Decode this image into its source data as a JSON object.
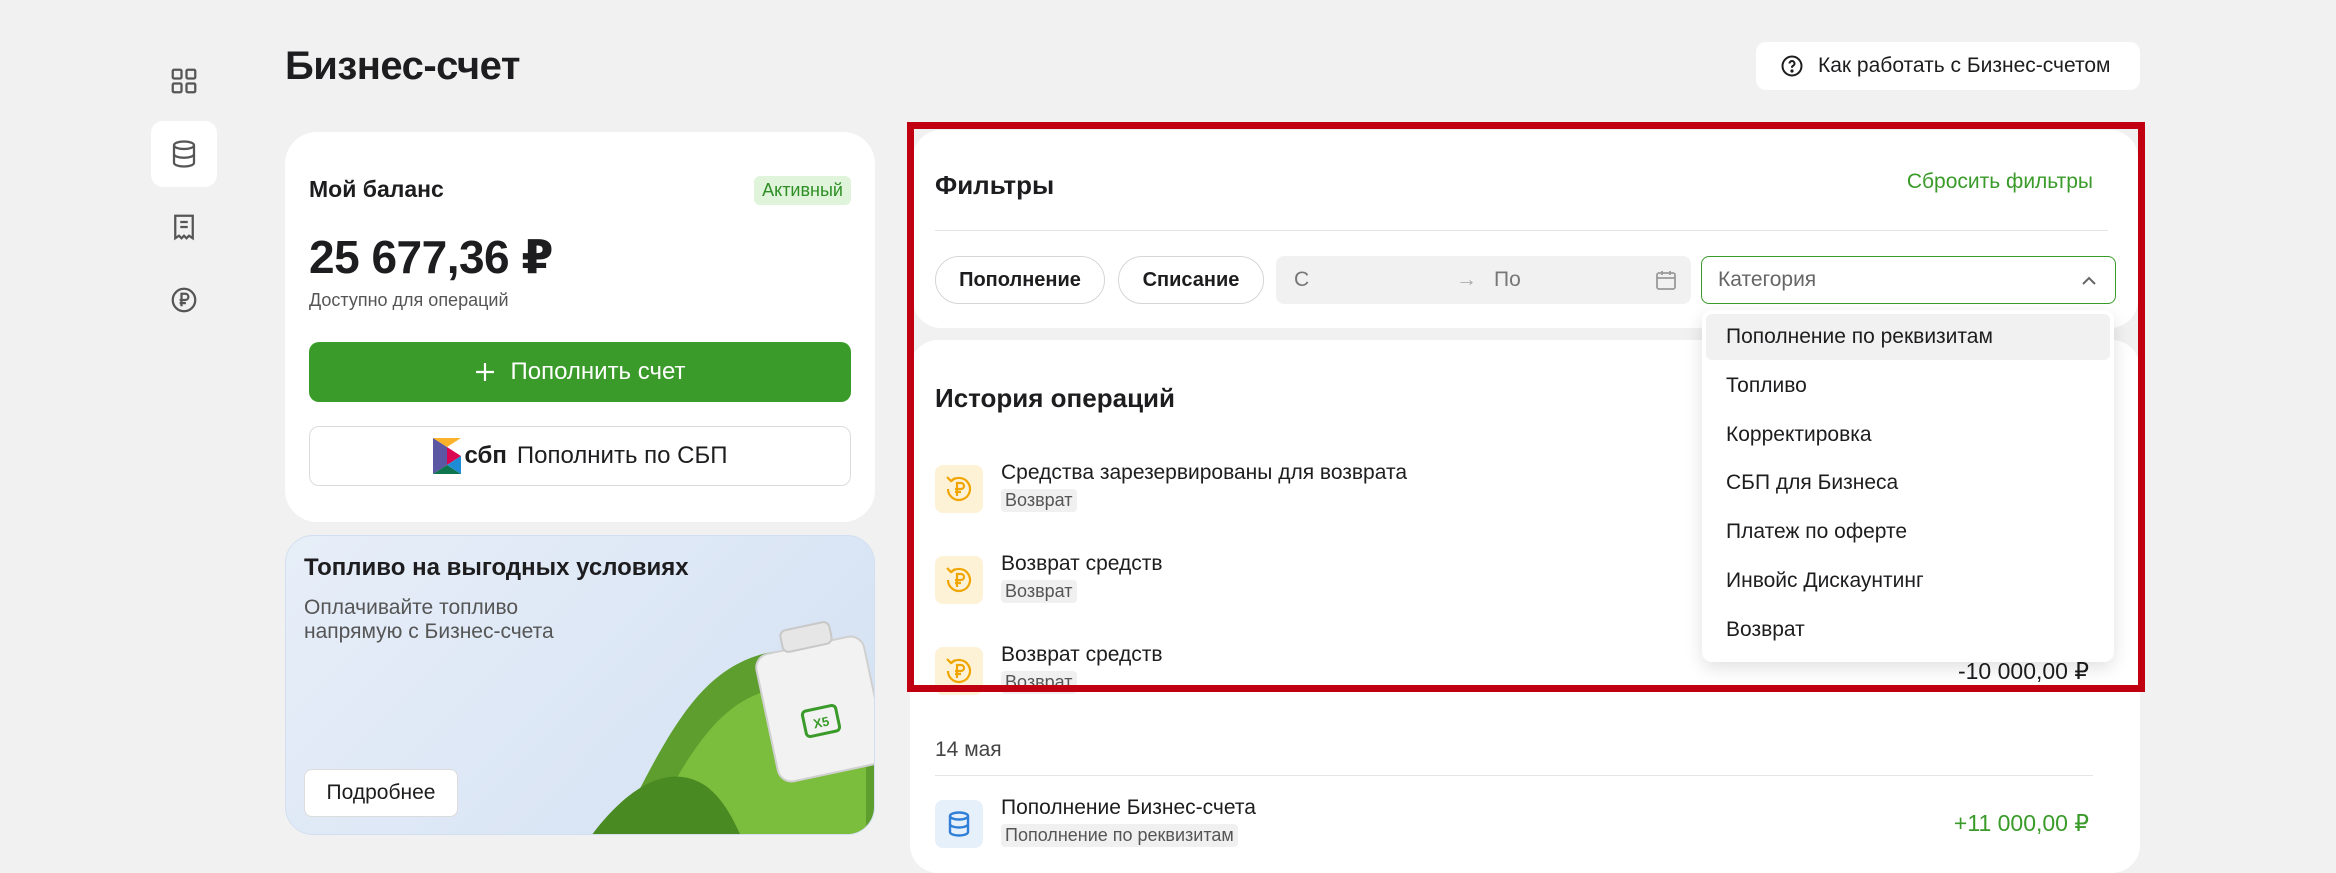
{
  "sidebar": {
    "items": [
      {
        "icon": "dashboard-grid-icon",
        "active": false
      },
      {
        "icon": "database-icon",
        "active": true
      },
      {
        "icon": "document-icon",
        "active": false
      },
      {
        "icon": "ruble-coin-icon",
        "active": false
      }
    ]
  },
  "header": {
    "title": "Бизнес-счет",
    "help_label": "Как работать с Бизнес-счетом"
  },
  "balance": {
    "title": "Мой баланс",
    "status": "Активный",
    "amount": "25 677,36 ₽",
    "subtitle": "Доступно для операций",
    "topup_label": "Пополнить счет",
    "sbp_logo_text": "сбп",
    "sbp_label": "Пополнить по СБП"
  },
  "promo": {
    "title": "Топливо на выгодных условиях",
    "text": "Оплачивайте топливо напрямую с Бизнес-счета",
    "button_label": "Подробнее",
    "canister_logo": "X5"
  },
  "filters": {
    "title": "Фильтры",
    "reset_label": "Сбросить фильтры",
    "chips": [
      "Пополнение",
      "Списание"
    ],
    "date_from_placeholder": "С",
    "date_arrow": "→",
    "date_to_placeholder": "По",
    "category_placeholder": "Категория"
  },
  "category_dropdown": {
    "options": [
      "Пополнение по реквизитам",
      "Топливо",
      "Корректировка",
      "СБП для Бизнеса",
      "Платеж по оферте",
      "Инвойс Дискаунтинг",
      "Возврат"
    ],
    "highlighted_index": 0
  },
  "history": {
    "title": "История операций",
    "operations": [
      {
        "name": "Средства зарезервированы для возврата",
        "tag": "Возврат",
        "amount": ""
      },
      {
        "name": "Возврат средств",
        "tag": "Возврат",
        "amount": ""
      },
      {
        "name": "Возврат средств",
        "tag": "Возврат",
        "amount": "-10 000,00 ₽"
      }
    ],
    "day_label": "14 мая",
    "day_operations": [
      {
        "name": "Пополнение Бизнес-счета",
        "tag": "Пополнение по реквизитам",
        "amount": "+11 000,00 ₽"
      }
    ]
  },
  "colors": {
    "accent_green": "#3a9b2a",
    "highlight_red": "#c00010",
    "badge_bg": "#e0f4db"
  }
}
